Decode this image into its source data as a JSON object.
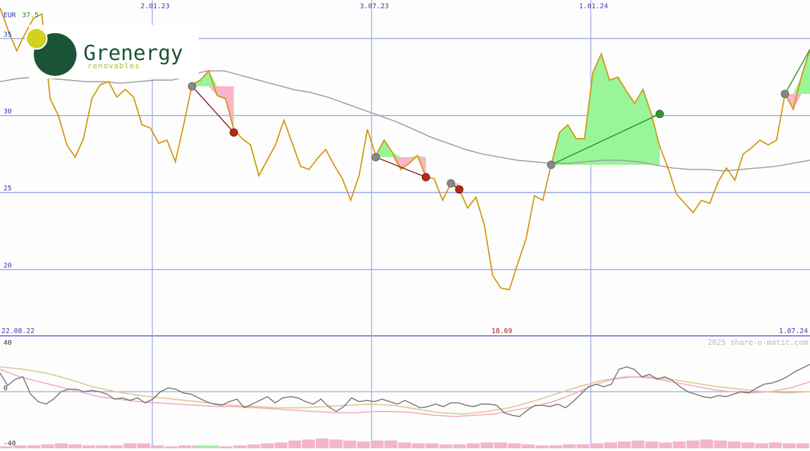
{
  "chart_data": [
    {
      "type": "line",
      "currency_label": "EUR",
      "max_value_label": "37.5",
      "min_value_label": "18.69",
      "logo": {
        "name": "Grenergy",
        "tagline": "renovables"
      },
      "x_tick_labels": [
        "2.01.23",
        "3.07.23",
        "1.01.24"
      ],
      "date_range": {
        "start": "22.08.22",
        "end": "1.07.24"
      },
      "y_ticks": [
        20,
        25,
        30,
        35
      ],
      "ylim": [
        15.7,
        37.5
      ],
      "series": [
        {
          "role": "price",
          "color": "#d4960f",
          "values": [
            37,
            35.5,
            34.2,
            35.3,
            36.3,
            36.6,
            31.1,
            30,
            28.1,
            27.3,
            28.5,
            31.1,
            32,
            32.2,
            31.2,
            31.7,
            31.2,
            29.4,
            29.2,
            28.2,
            28.4,
            27,
            29.4,
            32,
            32.3,
            32.9,
            31.3,
            31.1,
            29.1,
            28.5,
            28.1,
            26.1,
            27.1,
            28.1,
            29.7,
            28.2,
            26.7,
            26.5,
            27.2,
            27.8,
            26.8,
            25.9,
            24.5,
            26.1,
            29.1,
            27.4,
            28.4,
            27.6,
            26.5,
            26.9,
            27.4,
            26,
            25.9,
            24.5,
            25.6,
            25.2,
            24,
            24.7,
            22.9,
            19.6,
            18.8,
            18.7,
            20.4,
            22,
            24.8,
            24.5,
            26.8,
            28.9,
            29.4,
            28.5,
            28.5,
            32.8,
            34,
            32.3,
            32.5,
            31.6,
            30.8,
            31.7,
            30.1,
            28,
            26.6,
            24.9,
            24.3,
            23.7,
            24.5,
            24.3,
            25.7,
            26.6,
            25.8,
            27.5,
            27.9,
            28.4,
            28.1,
            28.4,
            31.4,
            30.4,
            32.6,
            34.3
          ]
        },
        {
          "role": "moving-average",
          "color": "#a0a0a0",
          "values": [
            32.2,
            32.4,
            32.5,
            32.4,
            32.3,
            32.2,
            32.2,
            32.1,
            32.2,
            32.3,
            32.3,
            32.6,
            32.9,
            32.9,
            32.6,
            32.3,
            32,
            31.7,
            31.5,
            31.2,
            30.8,
            30.4,
            30,
            29.6,
            29.1,
            28.6,
            28.2,
            27.8,
            27.5,
            27.3,
            27.1,
            27,
            26.9,
            26.9,
            27,
            27.1,
            27.1,
            27,
            26.8,
            26.6,
            26.5,
            26.5,
            26.4,
            26.5,
            26.6,
            26.7,
            26.9,
            27.1
          ]
        },
        {
          "role": "oscillator",
          "color": "#707070",
          "values": [
            15,
            5,
            10,
            12,
            -2,
            -8,
            -10,
            -6,
            0,
            2,
            2,
            0,
            1,
            0,
            -2,
            -6,
            -5,
            -7,
            -5,
            -9,
            -6,
            0,
            3,
            2,
            -1,
            -2,
            -5,
            -8,
            -10,
            -11,
            -8,
            -6,
            -13,
            -10,
            -7,
            -4,
            -9,
            -5,
            -4,
            -5,
            -8,
            -10,
            -6,
            -12,
            -16,
            -12,
            -5,
            -8,
            -7,
            -8,
            -6,
            -8,
            -10,
            -7,
            -10,
            -13,
            -12,
            -10,
            -12,
            -9,
            -9,
            -11,
            -12,
            -10,
            -10,
            -11,
            -17,
            -19,
            -20,
            -15,
            -11,
            -11,
            -12,
            -10,
            -13,
            -8,
            -2,
            4,
            6,
            4,
            6,
            18,
            20,
            18,
            12,
            14,
            10,
            12,
            9,
            4,
            0,
            -2,
            -4,
            -5,
            -3,
            -4,
            -2,
            0,
            -1,
            3,
            6,
            7,
            9,
            12,
            16,
            19,
            22
          ]
        },
        {
          "role": "signal-1",
          "color": "#f4a9c4",
          "values": [
            18,
            12,
            8,
            4,
            0,
            -4,
            -6,
            -8,
            -9,
            -10,
            -11,
            -12,
            -12,
            -13,
            -14,
            -15,
            -16,
            -17,
            -17,
            -16,
            -16,
            -17,
            -19,
            -20,
            -19,
            -18,
            -15,
            -12,
            -8,
            -2,
            5,
            10,
            12,
            11,
            8,
            5,
            2,
            0,
            -1,
            0,
            3,
            8
          ]
        },
        {
          "role": "signal-2",
          "color": "#e2c492",
          "values": [
            20,
            18,
            15,
            10,
            4,
            0,
            -3,
            -5,
            -7,
            -9,
            -11,
            -12,
            -13,
            -13,
            -12,
            -11,
            -10,
            -11,
            -14,
            -17,
            -18,
            -16,
            -13,
            -8,
            -2,
            4,
            9,
            12,
            12,
            10,
            7,
            4,
            2,
            0,
            -1,
            0
          ]
        }
      ],
      "trades": [
        {
          "result": "loss",
          "entry": 31.9,
          "exit": 28.9
        },
        {
          "result": "loss",
          "entry": 27.3,
          "exit": 26
        },
        {
          "result": "loss",
          "entry": 25.6,
          "exit": 25.2
        },
        {
          "result": "gain",
          "entry": 26.8,
          "exit": 30.1
        },
        {
          "result": "gain",
          "entry": 31.4,
          "exit": 34.3
        }
      ],
      "oscillator_ticks": [
        40,
        0,
        -40
      ],
      "oscillator_ylim": [
        -40,
        40
      ],
      "volume_values": [
        2,
        3,
        3,
        4,
        5,
        4,
        3,
        3,
        3,
        5,
        5,
        3,
        2,
        3,
        3,
        2,
        2,
        3,
        4,
        5,
        6,
        8,
        9,
        10,
        9,
        8,
        7,
        8,
        8,
        6,
        5,
        5,
        4,
        4,
        5,
        6,
        6,
        5,
        4,
        3,
        3,
        4,
        4,
        5,
        6,
        7,
        8,
        7,
        6,
        7,
        8,
        9,
        8,
        7,
        6,
        5,
        6,
        5,
        5
      ],
      "watermark": "2025 share-o-matic.com"
    }
  ]
}
